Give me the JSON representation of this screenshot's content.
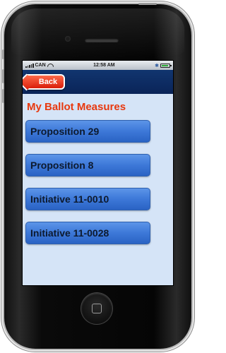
{
  "status_bar": {
    "carrier": "CAN",
    "time": "12:58 AM"
  },
  "nav": {
    "back_label": "Back"
  },
  "page": {
    "title": "My Ballot Measures"
  },
  "measures": [
    {
      "label": "Proposition 29"
    },
    {
      "label": "Proposition 8"
    },
    {
      "label": "Initiative 11-0010"
    },
    {
      "label": "Initiative 11-0028"
    }
  ],
  "colors": {
    "title": "#e8380e",
    "back_button": "#d91d0a",
    "navbar": "#0a2458",
    "screen_bg": "#d5e4f7",
    "measure_button": "#3d78d8"
  }
}
